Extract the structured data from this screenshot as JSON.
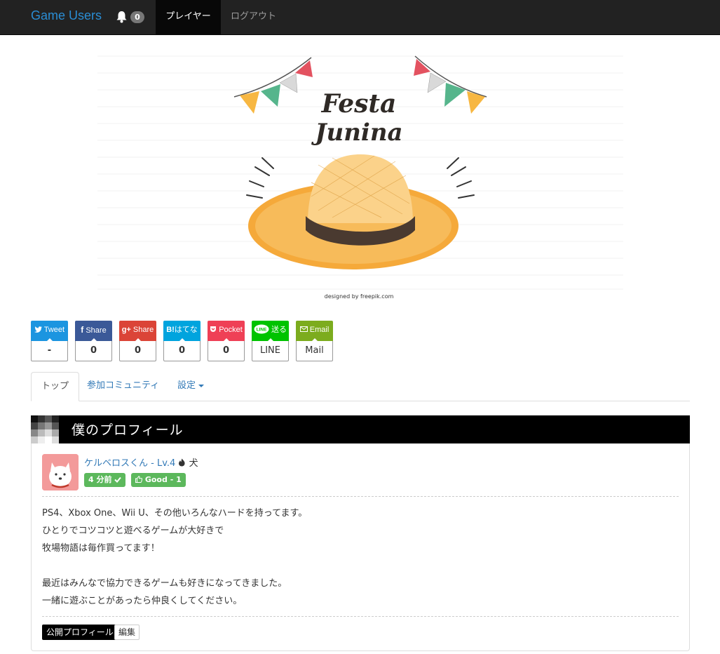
{
  "navbar": {
    "brand": "Game Users",
    "notification_count": "0",
    "items": [
      {
        "label": "プレイヤー",
        "active": true
      },
      {
        "label": "ログアウト",
        "active": false
      }
    ]
  },
  "hero": {
    "title_line1": "Festa",
    "title_line2": "Junina",
    "credit": "designed by freepik.com"
  },
  "share": [
    {
      "label": "Tweet",
      "count": "-",
      "icon": "twitter-icon",
      "color": "#1b95e0"
    },
    {
      "label": "Share",
      "count": "0",
      "icon": "facebook-icon",
      "color": "#3b5998"
    },
    {
      "label": "Share",
      "count": "0",
      "icon": "google-plus-icon",
      "color": "#db4437"
    },
    {
      "label": "はてな",
      "count": "0",
      "icon": "hatena-icon",
      "color": "#00a4de"
    },
    {
      "label": "Pocket",
      "count": "0",
      "icon": "pocket-icon",
      "color": "#ef4056"
    },
    {
      "label": "送る",
      "count": "LINE",
      "icon": "line-icon",
      "color": "#00c300"
    },
    {
      "label": "Email",
      "count": "Mail",
      "icon": "email-icon",
      "color": "#7cac1e"
    }
  ],
  "share_icon_text": {
    "hatena": "B!",
    "line": "LINE",
    "gplus": "g+"
  },
  "tabs": [
    {
      "label": "トップ",
      "active": true
    },
    {
      "label": "参加コミュニティ",
      "active": false
    },
    {
      "label": "設定",
      "active": false,
      "dropdown": true
    }
  ],
  "section": {
    "title": "僕のプロフィール"
  },
  "profile": {
    "name_level": "ケルベロスくん - Lv.4",
    "animal": "犬",
    "time_badge": "4 分前",
    "good_badge": "Good - 1",
    "bio": [
      "PS4、Xbox One、Wii U、その他いろんなハードを持ってます。",
      "ひとりでコツコツと遊べるゲームが大好きで",
      "牧場物語は毎作買ってます！",
      "",
      "最近はみんなで協力できるゲームも好きになってきました。",
      "一緒に遊ぶことがあったら仲良くしてください。"
    ],
    "public_profile_button": "公開プロフィール",
    "edit_button": "編集"
  },
  "colors": {
    "navbar_bg": "#222222",
    "brand": "#2a8dd4",
    "link": "#337ab7",
    "good": "#5cb85c"
  }
}
